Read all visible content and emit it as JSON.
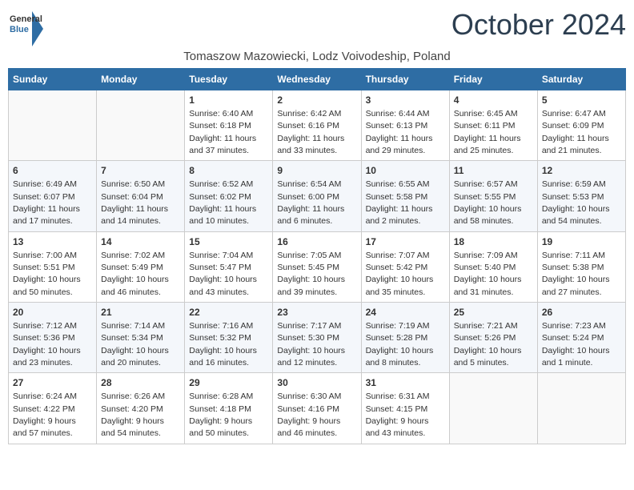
{
  "logo": {
    "general": "General",
    "blue": "Blue"
  },
  "title": "October 2024",
  "subtitle": "Tomaszow Mazowiecki, Lodz Voivodeship, Poland",
  "days_of_week": [
    "Sunday",
    "Monday",
    "Tuesday",
    "Wednesday",
    "Thursday",
    "Friday",
    "Saturday"
  ],
  "weeks": [
    [
      {
        "day": null
      },
      {
        "day": null
      },
      {
        "day": "1",
        "sunrise": "6:40 AM",
        "sunset": "6:18 PM",
        "daylight": "11 hours and 37 minutes."
      },
      {
        "day": "2",
        "sunrise": "6:42 AM",
        "sunset": "6:16 PM",
        "daylight": "11 hours and 33 minutes."
      },
      {
        "day": "3",
        "sunrise": "6:44 AM",
        "sunset": "6:13 PM",
        "daylight": "11 hours and 29 minutes."
      },
      {
        "day": "4",
        "sunrise": "6:45 AM",
        "sunset": "6:11 PM",
        "daylight": "11 hours and 25 minutes."
      },
      {
        "day": "5",
        "sunrise": "6:47 AM",
        "sunset": "6:09 PM",
        "daylight": "11 hours and 21 minutes."
      }
    ],
    [
      {
        "day": "6",
        "sunrise": "6:49 AM",
        "sunset": "6:07 PM",
        "daylight": "11 hours and 17 minutes."
      },
      {
        "day": "7",
        "sunrise": "6:50 AM",
        "sunset": "6:04 PM",
        "daylight": "11 hours and 14 minutes."
      },
      {
        "day": "8",
        "sunrise": "6:52 AM",
        "sunset": "6:02 PM",
        "daylight": "11 hours and 10 minutes."
      },
      {
        "day": "9",
        "sunrise": "6:54 AM",
        "sunset": "6:00 PM",
        "daylight": "11 hours and 6 minutes."
      },
      {
        "day": "10",
        "sunrise": "6:55 AM",
        "sunset": "5:58 PM",
        "daylight": "11 hours and 2 minutes."
      },
      {
        "day": "11",
        "sunrise": "6:57 AM",
        "sunset": "5:55 PM",
        "daylight": "10 hours and 58 minutes."
      },
      {
        "day": "12",
        "sunrise": "6:59 AM",
        "sunset": "5:53 PM",
        "daylight": "10 hours and 54 minutes."
      }
    ],
    [
      {
        "day": "13",
        "sunrise": "7:00 AM",
        "sunset": "5:51 PM",
        "daylight": "10 hours and 50 minutes."
      },
      {
        "day": "14",
        "sunrise": "7:02 AM",
        "sunset": "5:49 PM",
        "daylight": "10 hours and 46 minutes."
      },
      {
        "day": "15",
        "sunrise": "7:04 AM",
        "sunset": "5:47 PM",
        "daylight": "10 hours and 43 minutes."
      },
      {
        "day": "16",
        "sunrise": "7:05 AM",
        "sunset": "5:45 PM",
        "daylight": "10 hours and 39 minutes."
      },
      {
        "day": "17",
        "sunrise": "7:07 AM",
        "sunset": "5:42 PM",
        "daylight": "10 hours and 35 minutes."
      },
      {
        "day": "18",
        "sunrise": "7:09 AM",
        "sunset": "5:40 PM",
        "daylight": "10 hours and 31 minutes."
      },
      {
        "day": "19",
        "sunrise": "7:11 AM",
        "sunset": "5:38 PM",
        "daylight": "10 hours and 27 minutes."
      }
    ],
    [
      {
        "day": "20",
        "sunrise": "7:12 AM",
        "sunset": "5:36 PM",
        "daylight": "10 hours and 23 minutes."
      },
      {
        "day": "21",
        "sunrise": "7:14 AM",
        "sunset": "5:34 PM",
        "daylight": "10 hours and 20 minutes."
      },
      {
        "day": "22",
        "sunrise": "7:16 AM",
        "sunset": "5:32 PM",
        "daylight": "10 hours and 16 minutes."
      },
      {
        "day": "23",
        "sunrise": "7:17 AM",
        "sunset": "5:30 PM",
        "daylight": "10 hours and 12 minutes."
      },
      {
        "day": "24",
        "sunrise": "7:19 AM",
        "sunset": "5:28 PM",
        "daylight": "10 hours and 8 minutes."
      },
      {
        "day": "25",
        "sunrise": "7:21 AM",
        "sunset": "5:26 PM",
        "daylight": "10 hours and 5 minutes."
      },
      {
        "day": "26",
        "sunrise": "7:23 AM",
        "sunset": "5:24 PM",
        "daylight": "10 hours and 1 minute."
      }
    ],
    [
      {
        "day": "27",
        "sunrise": "6:24 AM",
        "sunset": "4:22 PM",
        "daylight": "9 hours and 57 minutes."
      },
      {
        "day": "28",
        "sunrise": "6:26 AM",
        "sunset": "4:20 PM",
        "daylight": "9 hours and 54 minutes."
      },
      {
        "day": "29",
        "sunrise": "6:28 AM",
        "sunset": "4:18 PM",
        "daylight": "9 hours and 50 minutes."
      },
      {
        "day": "30",
        "sunrise": "6:30 AM",
        "sunset": "4:16 PM",
        "daylight": "9 hours and 46 minutes."
      },
      {
        "day": "31",
        "sunrise": "6:31 AM",
        "sunset": "4:15 PM",
        "daylight": "9 hours and 43 minutes."
      },
      {
        "day": null
      },
      {
        "day": null
      }
    ]
  ]
}
